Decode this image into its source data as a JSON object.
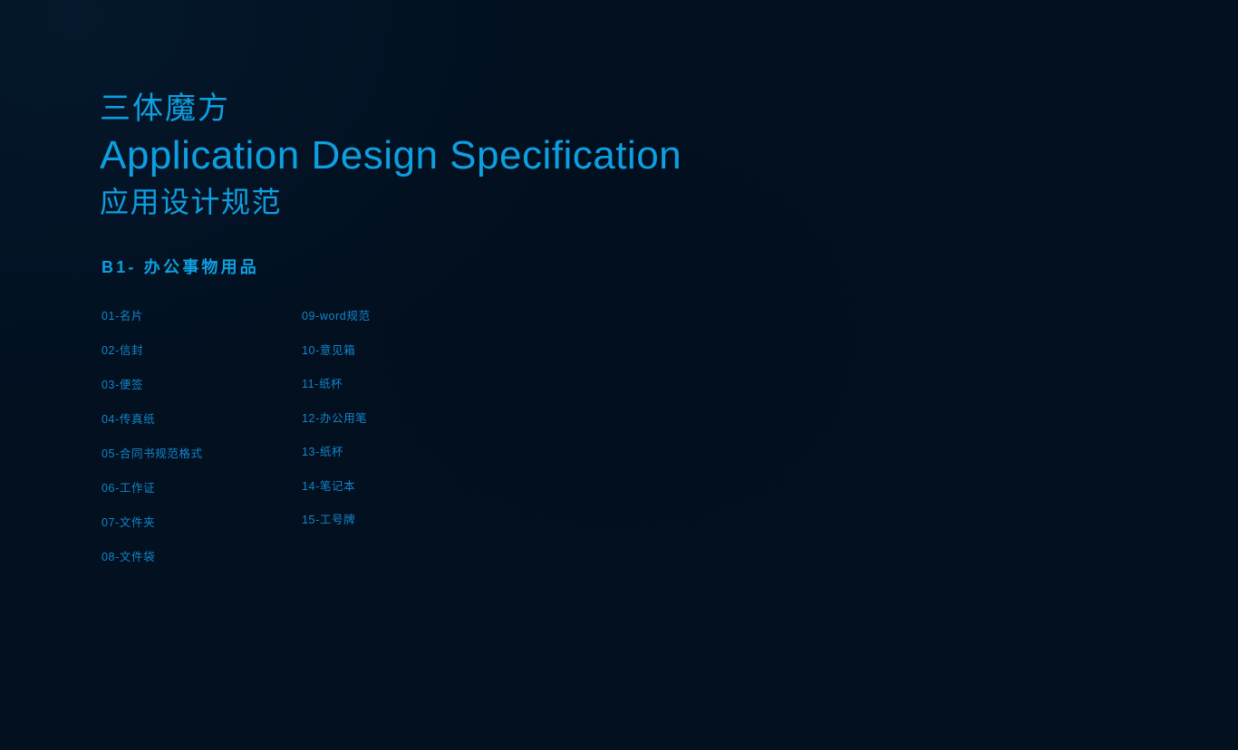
{
  "colors": {
    "background": "#021020",
    "title_accent": "#0e9fe0",
    "heading_accent": "#0e9fe0",
    "list_text": "#1287cc"
  },
  "title": {
    "cn_top": "三体魔方",
    "en": "Application Design Specification",
    "cn_bottom": "应用设计规范"
  },
  "section": {
    "heading": "B1- 办公事物用品"
  },
  "index": {
    "left_column": [
      {
        "label": "01-名片"
      },
      {
        "label": "02-信封"
      },
      {
        "label": "03-便签"
      },
      {
        "label": "04-传真纸"
      },
      {
        "label": "05-合同书规范格式"
      },
      {
        "label": "06-工作证"
      },
      {
        "label": "07-文件夹"
      },
      {
        "label": "08-文件袋"
      }
    ],
    "right_column": [
      {
        "label": "09-word规范"
      },
      {
        "label": "10-意见箱"
      },
      {
        "label": "11-纸杯"
      },
      {
        "label": "12-办公用笔"
      },
      {
        "label": "13-纸杯"
      },
      {
        "label": "14-笔记本"
      },
      {
        "label": "15-工号牌"
      }
    ]
  }
}
